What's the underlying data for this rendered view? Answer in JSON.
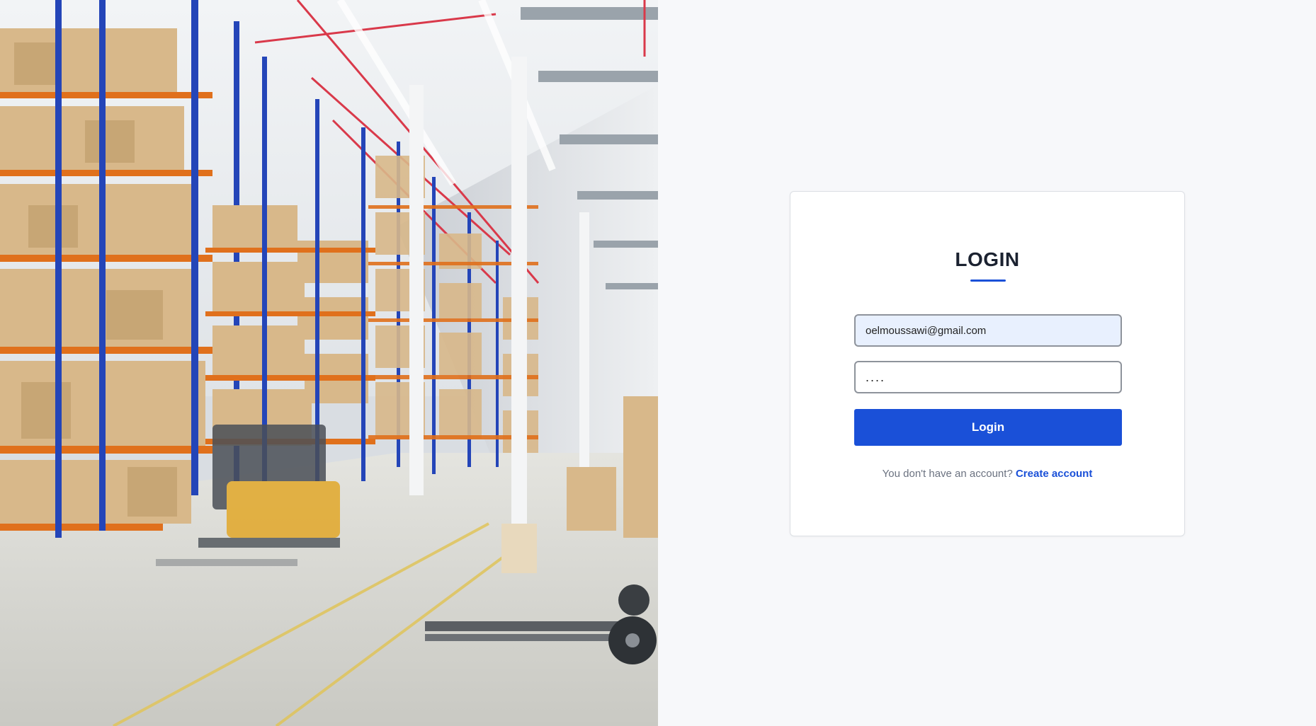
{
  "hero": {
    "image_description_icon": "warehouse-photo",
    "colors": {
      "rack_upright": "#2445b8",
      "rack_beam": "#e0701c",
      "pallet": "#d8b88a",
      "floor": "#d7d7d2",
      "ceiling": "#e9ecef",
      "forklift": "#e2a82a"
    }
  },
  "login": {
    "title": "LOGIN",
    "email_value": "oelmoussawi@gmail.com",
    "email_placeholder": "",
    "password_value": "....",
    "button_label": "Login",
    "signup_prompt": "You don't have an account?",
    "signup_link": "Create account"
  },
  "colors": {
    "accent": "#1a50d8",
    "page_bg": "#f7f8fa",
    "card_bg": "#ffffff",
    "email_bg": "#e8f0fe",
    "title_text": "#1b2230"
  }
}
